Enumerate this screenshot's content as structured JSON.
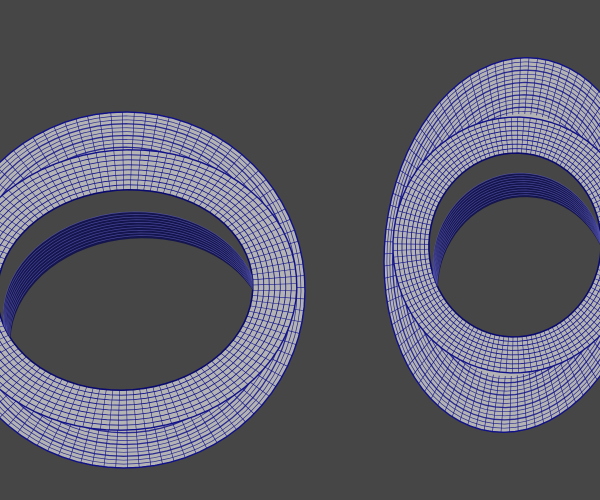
{
  "viewport": {
    "background": "#464646",
    "shading_color": "#b4b4b4",
    "wire_color": "#10108a",
    "dense_wire_color": "#0a0a6e"
  },
  "objects": [
    {
      "name": "tire-left",
      "type": "tire-wireframe-mesh"
    },
    {
      "name": "tire-right",
      "type": "tire-wireframe-mesh"
    }
  ]
}
